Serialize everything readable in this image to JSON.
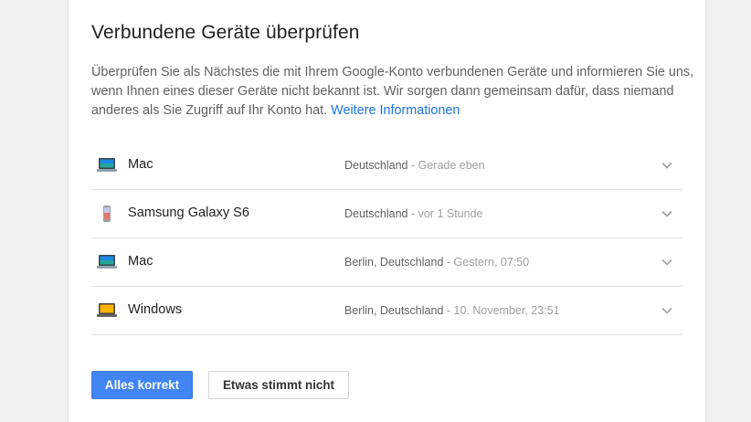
{
  "title": "Verbundene Geräte überprüfen",
  "description": {
    "text": "Überprüfen Sie als Nächstes die mit Ihrem Google-Konto verbundenen Geräte und informieren Sie uns, wenn Ihnen eines dieser Geräte nicht bekannt ist. Wir sorgen dann gemeinsam dafür, dass niemand anderes als Sie Zugriff auf Ihr Konto hat.",
    "link_label": "Weitere Informationen"
  },
  "devices": [
    {
      "icon": "laptop-icon",
      "name": "Mac",
      "location": "Deutschland",
      "separator": " - ",
      "time": "Gerade eben"
    },
    {
      "icon": "phone-icon",
      "name": "Samsung Galaxy S6",
      "location": "Deutschland",
      "separator": " - ",
      "time": "vor 1 Stunde"
    },
    {
      "icon": "laptop-icon",
      "name": "Mac",
      "location": "Berlin, Deutschland",
      "separator": " - ",
      "time": "Gestern, 07:50"
    },
    {
      "icon": "windows-laptop-icon",
      "name": "Windows",
      "location": "Berlin, Deutschland",
      "separator": " - ",
      "time": "10. November, 23:51"
    }
  ],
  "buttons": {
    "confirm_label": "Alles korrekt",
    "reject_label": "Etwas stimmt nicht"
  },
  "colors": {
    "accent": "#4285f4",
    "link": "#1a73e8"
  }
}
